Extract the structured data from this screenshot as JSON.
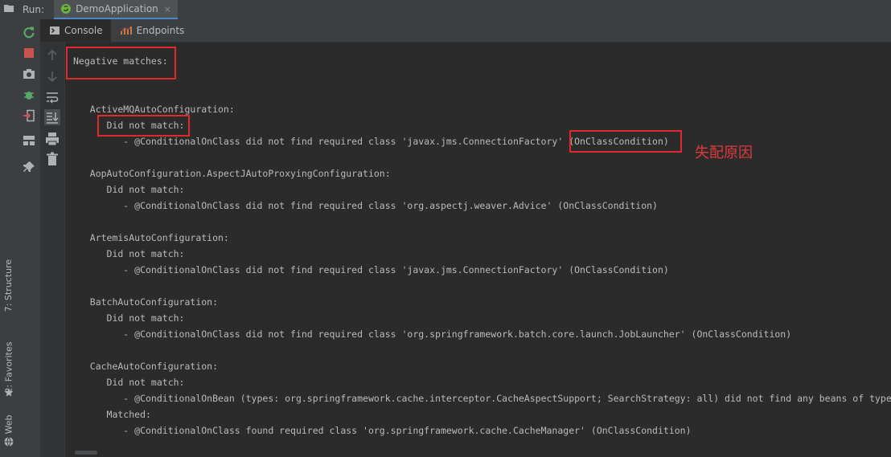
{
  "run_bar": {
    "label": "Run:",
    "tab_title": "DemoApplication",
    "close_glyph": "×"
  },
  "sub_tabs": [
    {
      "label": "Console",
      "icon": "console-icon",
      "active": true
    },
    {
      "label": "Endpoints",
      "icon": "endpoints-icon",
      "active": false
    }
  ],
  "side_tabs": {
    "structure": "7: Structure",
    "favorites": "2: Favorites",
    "web": "Web"
  },
  "console": {
    "lines": [
      "Negative matches:",
      "",
      "",
      "   ActiveMQAutoConfiguration:",
      "      Did not match:",
      "         - @ConditionalOnClass did not find required class 'javax.jms.ConnectionFactory' (OnClassCondition)",
      "",
      "   AopAutoConfiguration.AspectJAutoProxyingConfiguration:",
      "      Did not match:",
      "         - @ConditionalOnClass did not find required class 'org.aspectj.weaver.Advice' (OnClassCondition)",
      "",
      "   ArtemisAutoConfiguration:",
      "      Did not match:",
      "         - @ConditionalOnClass did not find required class 'javax.jms.ConnectionFactory' (OnClassCondition)",
      "",
      "   BatchAutoConfiguration:",
      "      Did not match:",
      "         - @ConditionalOnClass did not find required class 'org.springframework.batch.core.launch.JobLauncher' (OnClassCondition)",
      "",
      "   CacheAutoConfiguration:",
      "      Did not match:",
      "         - @ConditionalOnBean (types: org.springframework.cache.interceptor.CacheAspectSupport; SearchStrategy: all) did not find any beans of type org.springframework.cache.interceptor.CacheAspectSupport (OnBeanCondition)",
      "      Matched:",
      "         - @ConditionalOnClass found required class 'org.springframework.cache.CacheManager' (OnClassCondition)"
    ]
  },
  "annotation": {
    "text": "失配原因",
    "color": "#e0292e"
  },
  "colors": {
    "background": "#2b2b2b",
    "panel": "#3c3f41",
    "text": "#bbbbbb",
    "highlight_box": "#e0292e",
    "spring_green": "#6cb33e"
  }
}
